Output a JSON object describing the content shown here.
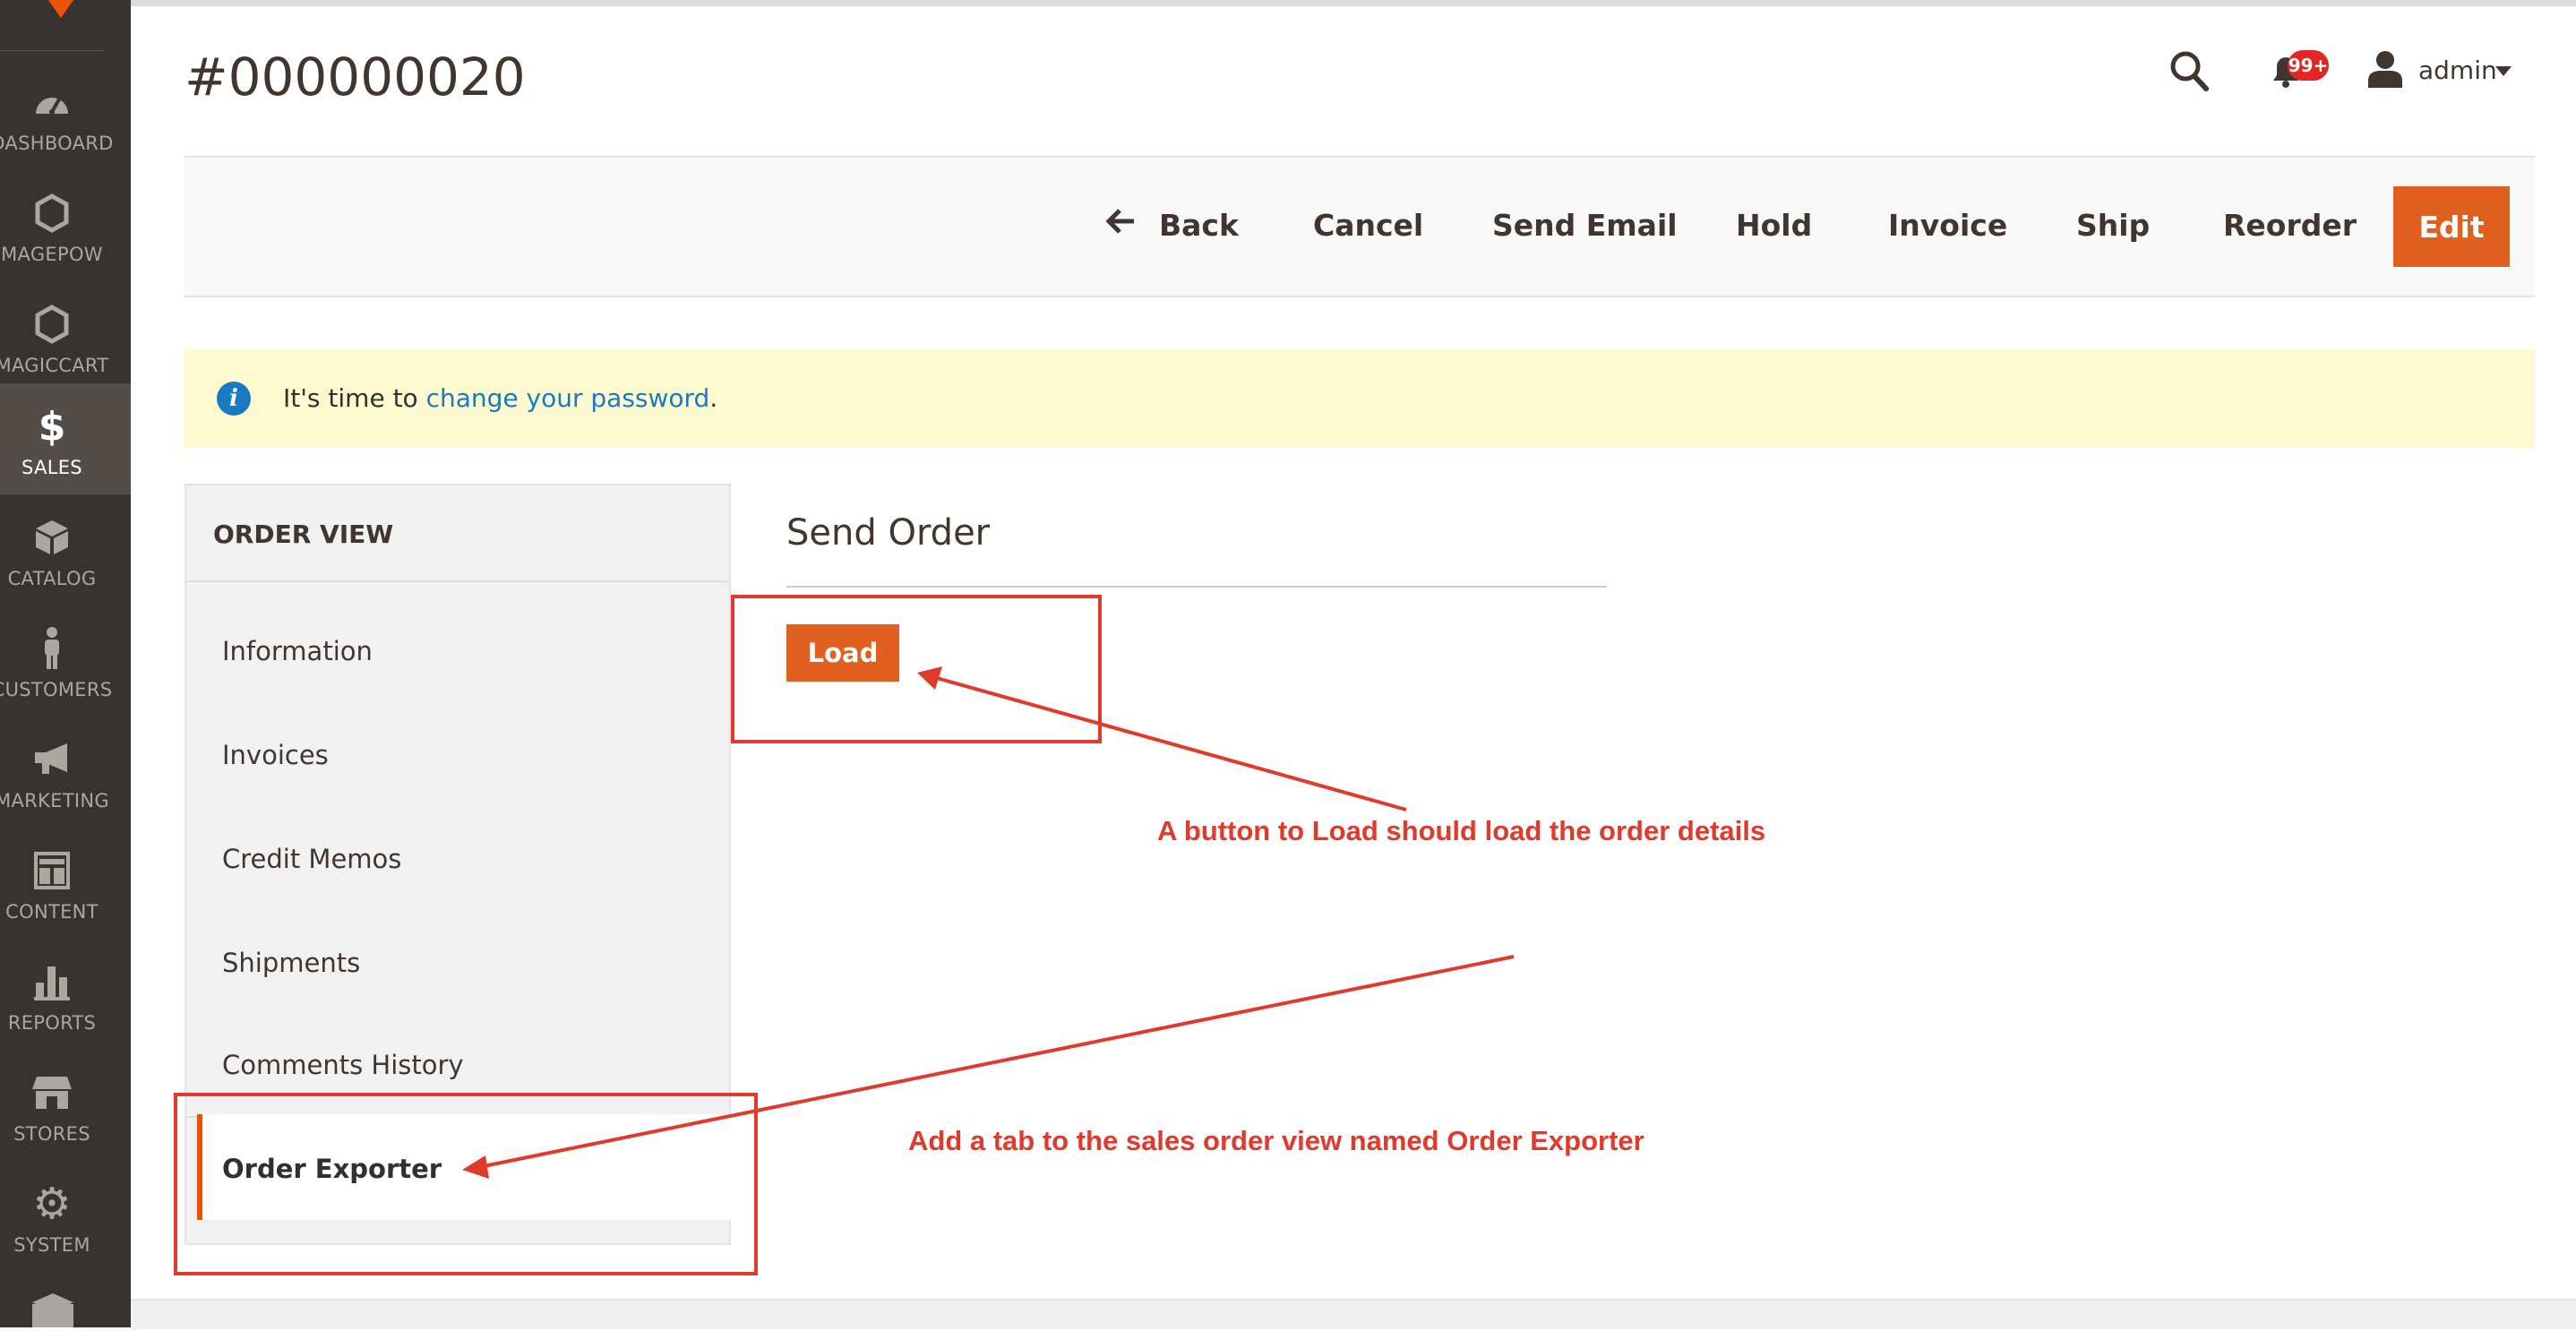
{
  "sidebar": {
    "items": [
      {
        "label": "DASHBOARD",
        "icon": "dashboard-icon"
      },
      {
        "label": "MAGEPOW",
        "icon": "hexagon-icon"
      },
      {
        "label": "MAGICCART",
        "icon": "hexagon-icon"
      },
      {
        "label": "SALES",
        "icon": "dollar-icon",
        "active": true
      },
      {
        "label": "CATALOG",
        "icon": "box-icon"
      },
      {
        "label": "CUSTOMERS",
        "icon": "person-icon"
      },
      {
        "label": "MARKETING",
        "icon": "megaphone-icon"
      },
      {
        "label": "CONTENT",
        "icon": "layout-icon"
      },
      {
        "label": "REPORTS",
        "icon": "bar-chart-icon"
      },
      {
        "label": "STORES",
        "icon": "store-icon"
      },
      {
        "label": "SYSTEM",
        "icon": "gear-icon"
      }
    ]
  },
  "header": {
    "title": "#000000020",
    "notifications_badge": "99+",
    "user": "admin"
  },
  "actions": {
    "back": "Back",
    "cancel": "Cancel",
    "send_email": "Send Email",
    "hold": "Hold",
    "invoice": "Invoice",
    "ship": "Ship",
    "reorder": "Reorder",
    "edit": "Edit"
  },
  "notice": {
    "prefix": "It's time to ",
    "link": "change your password",
    "suffix": "."
  },
  "tabs": {
    "title": "ORDER VIEW",
    "items": [
      "Information",
      "Invoices",
      "Credit Memos",
      "Shipments",
      "Comments History"
    ],
    "active": "Order Exporter"
  },
  "content": {
    "section_title": "Send Order",
    "load_button": "Load"
  },
  "annotations": {
    "load_note": "A button to Load should load the order details",
    "tab_note": "Add a tab to the sales order view named Order Exporter",
    "color": "#e03a2c"
  },
  "colors": {
    "accent": "#eb5202",
    "button": "#e1601f",
    "sidebar": "#373330",
    "link": "#1979c3",
    "notice_bg": "#fdfacf"
  }
}
